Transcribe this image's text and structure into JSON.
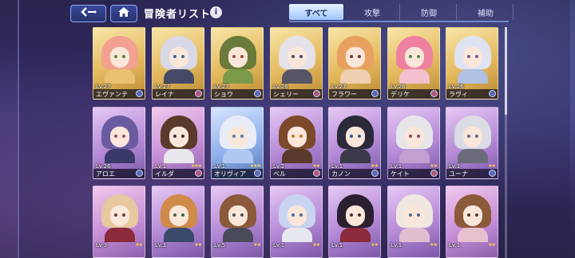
{
  "header": {
    "back_icon": "back-arrow-icon",
    "home_icon": "home-icon",
    "title": "冒険者リスト",
    "info_label": "i"
  },
  "tabs": [
    {
      "label": "すべて",
      "active": true
    },
    {
      "label": "攻撃",
      "active": false
    },
    {
      "label": "防御",
      "active": false
    },
    {
      "label": "補助",
      "active": false
    }
  ],
  "rows": [
    [
      {
        "name": "エヴァンテ",
        "level": "Lv.27",
        "frame": "gold",
        "hair": "#f2a090",
        "outfit": "#e8c070",
        "eyes": "#5a8a3a",
        "stars": ""
      },
      {
        "name": "レイナ",
        "level": "Lv.27",
        "frame": "gold",
        "hair": "#d8d8e6",
        "outfit": "#444a66",
        "eyes": "#3a6aa0",
        "stars": ""
      },
      {
        "name": "ショウ",
        "level": "Lv.27",
        "frame": "gold",
        "hair": "#6a7a3a",
        "outfit": "#7a9a4a",
        "eyes": "#a04a3a",
        "stars": ""
      },
      {
        "name": "シェリー",
        "level": "Lv.26",
        "frame": "gold",
        "hair": "#e4e2e8",
        "outfit": "#555566",
        "eyes": "#4a4a6a",
        "stars": ""
      },
      {
        "name": "フラワー",
        "level": "Lv.27",
        "frame": "gold",
        "hair": "#e8a060",
        "outfit": "#f0d0b0",
        "eyes": "#6a3a2a",
        "stars": ""
      },
      {
        "name": "デリケ",
        "level": "Lv.26",
        "frame": "gold",
        "hair": "#ee80a0",
        "outfit": "#f4c0d0",
        "eyes": "#4a8a4a",
        "stars": ""
      },
      {
        "name": "ラヴィ",
        "level": "Lv.26",
        "frame": "gold",
        "hair": "#dfe2f0",
        "outfit": "#b0c0e0",
        "eyes": "#7a5aa0",
        "stars": ""
      }
    ],
    [
      {
        "name": "アロエ",
        "level": "Lv.26",
        "frame": "purple",
        "hair": "#6a5aa0",
        "outfit": "#3a3a6a",
        "eyes": "#a04a6a",
        "stars": ""
      },
      {
        "name": "イルダ",
        "level": "Lv.1",
        "frame": "pink",
        "hair": "#5a3a2a",
        "outfit": "#e8e8ee",
        "eyes": "#3a2a2a",
        "stars": "★★★"
      },
      {
        "name": "オリヴィア",
        "level": "Lv.1",
        "frame": "blue",
        "hair": "#e8ecf6",
        "outfit": "#b0c8f0",
        "eyes": "#5a7ab0",
        "stars": "★★★"
      },
      {
        "name": "ベル",
        "level": "Lv.2",
        "frame": "purple",
        "hair": "#7a4a2a",
        "outfit": "#5a3a2a",
        "eyes": "#c07a2a",
        "stars": "★★"
      },
      {
        "name": "カノン",
        "level": "Lv.1",
        "frame": "purple",
        "hair": "#2a2a3a",
        "outfit": "#3a3a4a",
        "eyes": "#2a5a8a",
        "stars": "★★"
      },
      {
        "name": "ケイト",
        "level": "Lv.1",
        "frame": "purple",
        "hair": "#e6e6ea",
        "outfit": "#c0a0d0",
        "eyes": "#8a4a6a",
        "stars": "★★"
      },
      {
        "name": "ユーナ",
        "level": "Lv.1",
        "frame": "purple",
        "hair": "#dcdce4",
        "outfit": "#6a6a7a",
        "eyes": "#5a6a8a",
        "stars": "★★"
      }
    ],
    [
      {
        "name": "",
        "level": "Lv.3",
        "frame": "pink",
        "hair": "#e8c8a0",
        "outfit": "#8a2a3a",
        "eyes": "#6a3a3a",
        "stars": "★★"
      },
      {
        "name": "",
        "level": "Lv.1",
        "frame": "purple",
        "hair": "#d08a4a",
        "outfit": "#3a4a6a",
        "eyes": "#3a6a3a",
        "stars": "★★"
      },
      {
        "name": "",
        "level": "Lv.5",
        "frame": "purple",
        "hair": "#8a5a3a",
        "outfit": "#4a4a5a",
        "eyes": "#4a4a4a",
        "stars": "★★"
      },
      {
        "name": "",
        "level": "Lv.1",
        "frame": "purple",
        "hair": "#c8d4f0",
        "outfit": "#e8e8f0",
        "eyes": "#4a6aa0",
        "stars": "★★"
      },
      {
        "name": "",
        "level": "Lv.1",
        "frame": "purple",
        "hair": "#2a2030",
        "outfit": "#8a2a3a",
        "eyes": "#4a2a2a",
        "stars": "★★"
      },
      {
        "name": "",
        "level": "Lv.1",
        "frame": "purple",
        "hair": "#f0e8e0",
        "outfit": "#e0c0d0",
        "eyes": "#4a6a8a",
        "stars": "★★"
      },
      {
        "name": "",
        "level": "Lv.1",
        "frame": "pink",
        "hair": "#8a5a3a",
        "outfit": "#e8c0d0",
        "eyes": "#5a3a2a",
        "stars": "★★"
      }
    ]
  ]
}
